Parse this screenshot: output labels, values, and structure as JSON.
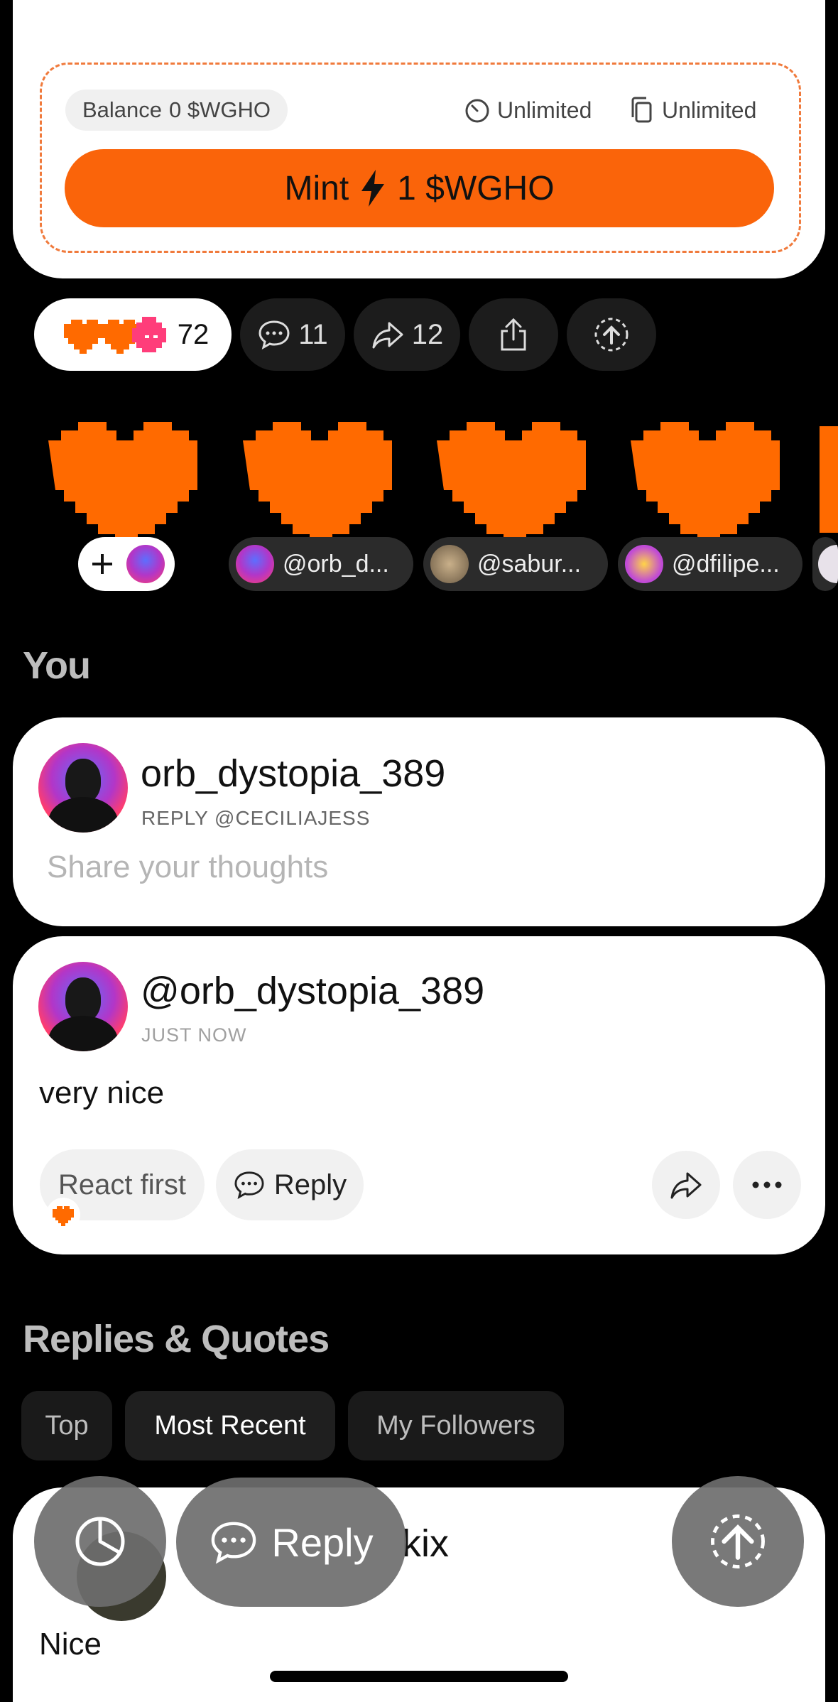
{
  "mint": {
    "balance_label": "Balance",
    "balance_value": "0 $WGHO",
    "time_limit": "Unlimited",
    "supply_limit": "Unlimited",
    "mint_label": "Mint",
    "mint_amount": "1 $WGHO"
  },
  "actions": {
    "reactions_count": "72",
    "comments_count": "11",
    "shares_count": "12"
  },
  "reactors": [
    {
      "handle": "@orb_d..."
    },
    {
      "handle": "@sabur..."
    },
    {
      "handle": "@dfilipe..."
    }
  ],
  "you_section": {
    "title": "You",
    "composer_username": "orb_dystopia_389",
    "composer_reply_to": "REPLY @CECILIAJESS",
    "composer_placeholder": "Share your thoughts"
  },
  "my_reply": {
    "handle": "@orb_dystopia_389",
    "time": "JUST NOW",
    "text": "very nice",
    "react_label": "React first",
    "reply_label": "Reply"
  },
  "replies_section": {
    "title": "Replies & Quotes",
    "filters": [
      "Top",
      "Most Recent",
      "My Followers"
    ],
    "active_filter": "Most Recent"
  },
  "next_reply": {
    "handle_fragment": "kix",
    "text": "Nice"
  },
  "fab": {
    "reply_label": "Reply"
  },
  "colors": {
    "accent": "#fa640a",
    "heart": "#ff6a00"
  }
}
